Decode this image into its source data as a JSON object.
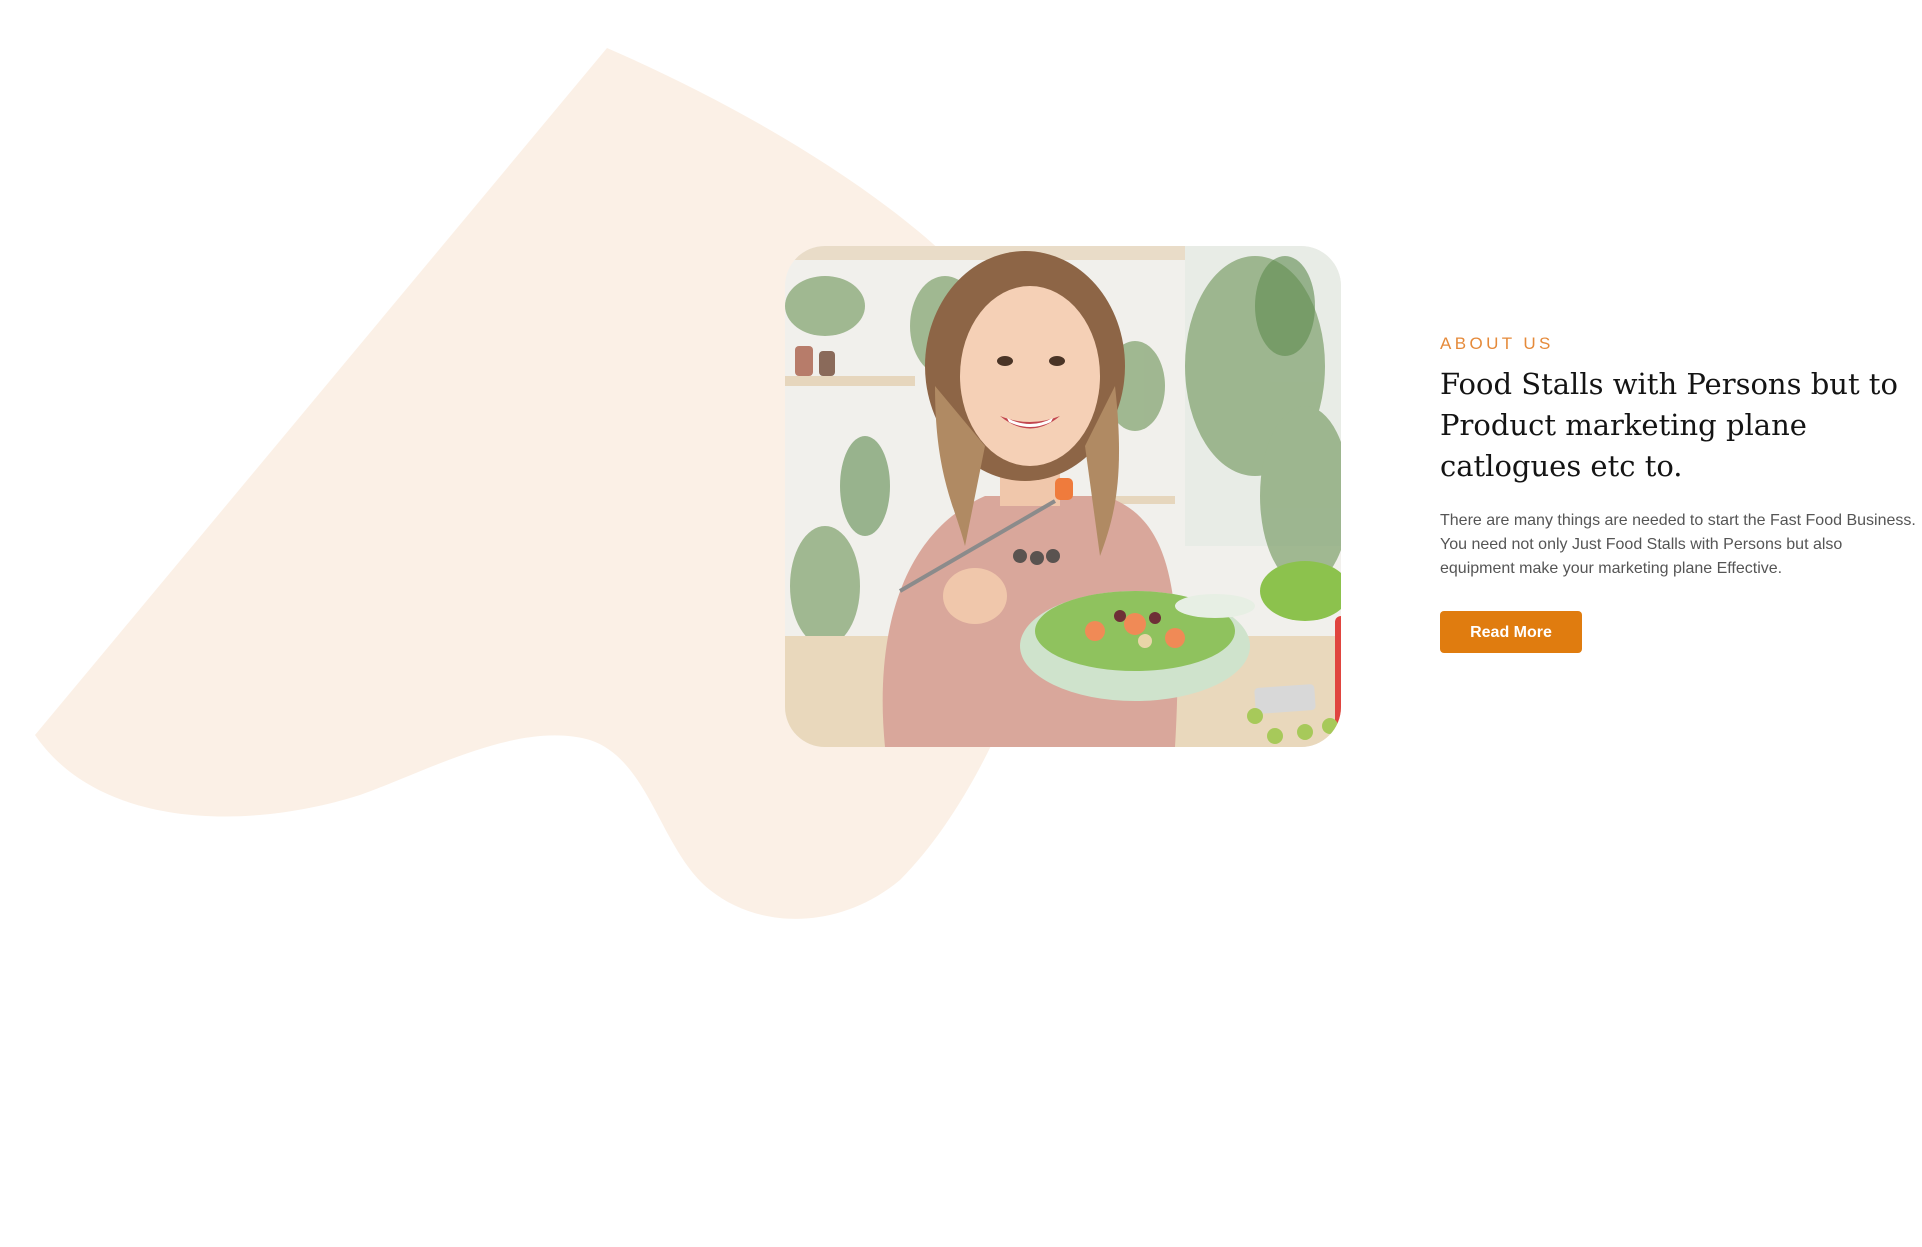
{
  "about": {
    "eyebrow": "ABOUT US",
    "heading": "Food Stalls with Persons but  to Product marketing plane catlogues etc to.",
    "description": "There are many things are needed to start the Fast Food Business. You need not only Just Food Stalls with Persons but also equipment  make your marketing plane Effective.",
    "button_label": "Read More"
  },
  "colors": {
    "accent": "#e07c0f",
    "eyebrow": "#e58a3a",
    "blob": "#fbf0e6",
    "heading": "#141414",
    "body_text": "#555555"
  },
  "image": {
    "subject": "woman-eating-salad-photo"
  }
}
